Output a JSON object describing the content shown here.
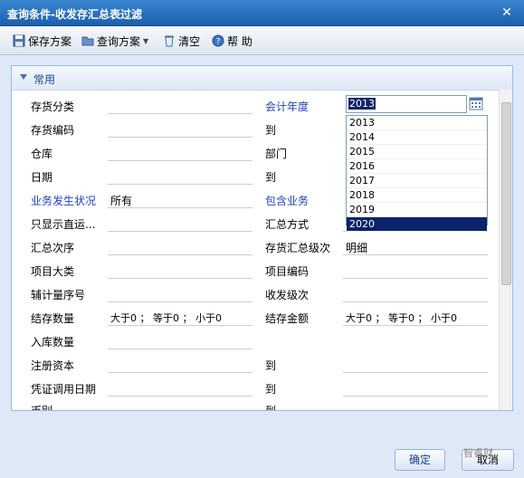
{
  "window": {
    "title": "查询条件-收发存汇总表过滤"
  },
  "toolbar": {
    "save_scheme": "保存方案",
    "query_scheme": "查询方案",
    "clear": "清空",
    "help": "帮 助"
  },
  "section": {
    "title": "常用"
  },
  "left_fields": [
    {
      "label": "存货分类",
      "value": ""
    },
    {
      "label": "存货编码",
      "value": ""
    },
    {
      "label": "仓库",
      "value": ""
    },
    {
      "label": "日期",
      "value": ""
    },
    {
      "label": "业务发生状况",
      "value": "所有"
    },
    {
      "label": "只显示直运...",
      "value": ""
    },
    {
      "label": "汇总次序",
      "value": ""
    },
    {
      "label": "项目大类",
      "value": ""
    },
    {
      "label": "辅计量序号",
      "value": ""
    },
    {
      "label": "结存数量",
      "value": "大于0 ； 等于0 ； 小于0"
    },
    {
      "label": "入库数量",
      "value": ""
    },
    {
      "label": "注册资本",
      "value": ""
    },
    {
      "label": "凭证调用日期",
      "value": ""
    },
    {
      "label": "币别",
      "value": ""
    }
  ],
  "right_fields": [
    {
      "label": "会计年度",
      "value": ""
    },
    {
      "label": "到",
      "value": ""
    },
    {
      "label": "部门",
      "value": ""
    },
    {
      "label": "到",
      "value": ""
    },
    {
      "label": "包含业务",
      "value": ""
    },
    {
      "label": "汇总方式",
      "value": ""
    },
    {
      "label": "存货汇总级次",
      "value": "明细"
    },
    {
      "label": "项目编码",
      "value": ""
    },
    {
      "label": "收发级次",
      "value": ""
    },
    {
      "label": "结存金额",
      "value": "大于0 ； 等于0 ； 小于0"
    },
    {
      "label": "",
      "value": ""
    },
    {
      "label": "到",
      "value": ""
    },
    {
      "label": "到",
      "value": ""
    },
    {
      "label": "到",
      "value": ""
    }
  ],
  "year_input": {
    "value": "2013"
  },
  "year_options": [
    "2013",
    "2014",
    "2015",
    "2016",
    "2017",
    "2018",
    "2019",
    "2020"
  ],
  "year_selected": "2020",
  "footer": {
    "ok": "确定",
    "cancel": "取消",
    "watermark": "智睿财"
  },
  "colors": {
    "title_bar": "#1d5fae",
    "accent_label": "#1e3fc0",
    "selection": "#0a246a"
  }
}
